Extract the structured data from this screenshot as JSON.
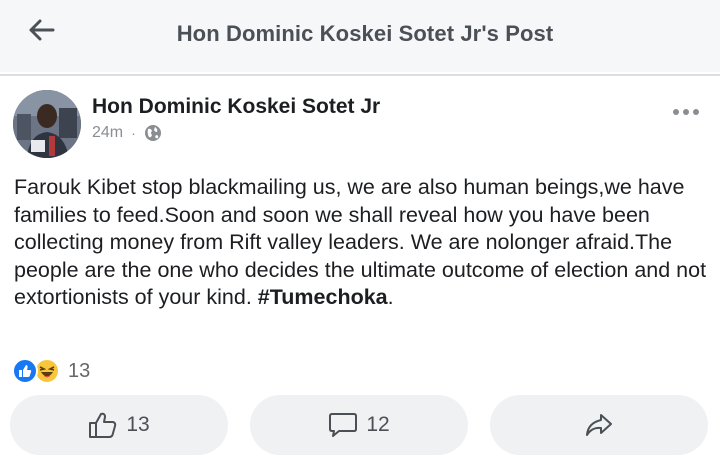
{
  "header": {
    "title": "Hon Dominic Koskei Sotet Jr's Post",
    "back_icon": "arrow-left-icon"
  },
  "post": {
    "author": "Hon Dominic Koskei Sotet Jr",
    "time": "24m",
    "separator": "·",
    "audience_icon": "globe-icon",
    "more_icon": "more-horizontal-icon",
    "body": "Farouk Kibet stop blackmailing us, we are also human beings,we have families to feed.Soon and soon we shall reveal how you have been collecting money from Rift valley leaders. We are nolonger afraid.The people are the one who decides the ultimate outcome of election and not extortionists of your kind.",
    "hashtag": "#Tumechoka",
    "hashtag_suffix": "."
  },
  "reactions": {
    "icons": [
      "like-reaction-icon",
      "haha-reaction-icon"
    ],
    "count": "13"
  },
  "actions": {
    "like": {
      "icon": "thumbs-up-icon",
      "count": "13"
    },
    "comment": {
      "icon": "comment-icon",
      "count": "12"
    },
    "share": {
      "icon": "share-icon"
    }
  },
  "colors": {
    "header_bg": "#f6f7f9",
    "title_text": "#4b4f56",
    "meta_text": "#8a8d91",
    "like_blue": "#1877f2",
    "haha_yellow": "#f7c63b",
    "button_bg": "#f0f1f3"
  }
}
